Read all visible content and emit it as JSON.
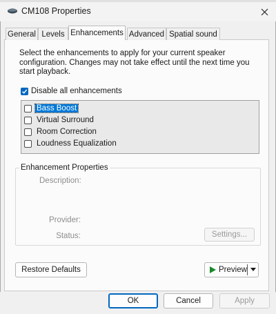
{
  "window": {
    "title": "CM108 Properties"
  },
  "tabs": [
    {
      "label": "General"
    },
    {
      "label": "Levels"
    },
    {
      "label": "Enhancements"
    },
    {
      "label": "Advanced"
    },
    {
      "label": "Spatial sound"
    }
  ],
  "active_tab": "Enhancements",
  "enhancements": {
    "description": "Select the enhancements to apply for your current speaker configuration. Changes may not take effect until the next time you start playback.",
    "disable_all_label": "Disable all enhancements",
    "disable_all_checked": true,
    "items": [
      {
        "label": "Bass Boost",
        "checked": false,
        "selected": true
      },
      {
        "label": "Virtual Surround",
        "checked": false
      },
      {
        "label": "Room Correction",
        "checked": false
      },
      {
        "label": "Loudness Equalization",
        "checked": false
      }
    ]
  },
  "properties": {
    "title": "Enhancement Properties",
    "description_label": "Description:",
    "provider_label": "Provider:",
    "status_label": "Status:",
    "settings_button": "Settings..."
  },
  "buttons": {
    "restore_defaults": "Restore Defaults",
    "preview": "Preview",
    "ok": "OK",
    "cancel": "Cancel",
    "apply": "Apply"
  },
  "colors": {
    "accent": "#0067c0",
    "preview_arrow": "#1a8a2a"
  },
  "icons": {
    "app": "speaker-icon",
    "close": "close-icon",
    "play": "play-icon",
    "dropdown": "chevron-down-icon"
  }
}
